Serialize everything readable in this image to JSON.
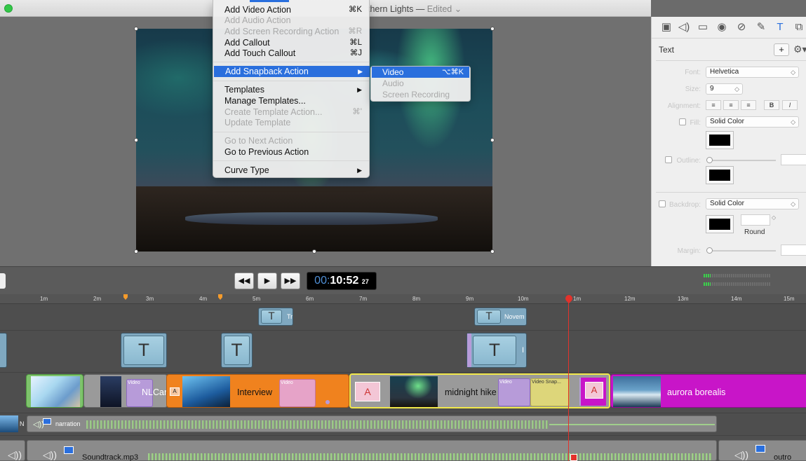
{
  "window": {
    "title": "Northern Lights",
    "title_visible": "thern Lights",
    "separator": "—",
    "status": "Edited",
    "status_chevron": "⌄"
  },
  "context_menu": {
    "items": [
      {
        "label": "Add Video Action",
        "shortcut": "⌘K",
        "enabled": true
      },
      {
        "label": "Add Audio Action",
        "shortcut": "",
        "enabled": false
      },
      {
        "label": "Add Screen Recording Action",
        "shortcut": "⌘R",
        "enabled": false
      },
      {
        "label": "Add Callout",
        "shortcut": "⌘L",
        "enabled": true
      },
      {
        "label": "Add Touch Callout",
        "shortcut": "⌘J",
        "enabled": true
      },
      {
        "label": "Add Snapback Action",
        "shortcut": "▶",
        "enabled": true,
        "highlighted": true
      },
      {
        "label": "Templates",
        "shortcut": "▶",
        "enabled": true
      },
      {
        "label": "Manage Templates...",
        "shortcut": "",
        "enabled": true
      },
      {
        "label": "Create Template Action...",
        "shortcut": "⌘'",
        "enabled": false
      },
      {
        "label": "Update Template",
        "shortcut": "",
        "enabled": false
      },
      {
        "label": "Go to Next Action",
        "shortcut": "",
        "enabled": false
      },
      {
        "label": "Go to Previous Action",
        "shortcut": "",
        "enabled": true
      },
      {
        "label": "Curve Type",
        "shortcut": "▶",
        "enabled": true
      }
    ],
    "submenu": [
      {
        "label": "Video",
        "shortcut": "⌥⌘K",
        "highlighted": true
      },
      {
        "label": "Audio",
        "shortcut": ""
      },
      {
        "label": "Screen Recording",
        "shortcut": ""
      }
    ]
  },
  "inspector": {
    "toolbar_icons": [
      "film-icon",
      "speaker-icon",
      "screen-icon",
      "cursor-icon",
      "shapes-icon",
      "pen-icon",
      "text-icon",
      "layers-icon"
    ],
    "toolbar_glyphs": [
      "▣",
      "◁)",
      "▭",
      "◉",
      "⊘",
      "✎",
      "T",
      "⧉"
    ],
    "title": "Text",
    "plus": "+",
    "gear": "⚙▾",
    "font_label": "Font:",
    "font_value": "Helvetica",
    "size_label": "Size:",
    "size_value": "9",
    "alignment_label": "Alignment:",
    "align_buttons": [
      "≡",
      "≡",
      "≡"
    ],
    "bold": "B",
    "italic": "I",
    "fill_label": "Fill:",
    "fill_value": "Solid Color",
    "fill_color": "#000000",
    "outline_label": "Outline:",
    "outline_color": "#000000",
    "backdrop_label": "Backdrop:",
    "backdrop_value": "Solid Color",
    "backdrop_color": "#000000",
    "round_label": "Round",
    "margin_label": "Margin:",
    "chevron": "◇"
  },
  "transport": {
    "rewind": "◀◀",
    "play": "▶",
    "forward": "▶▶",
    "time_dim": "00:",
    "time_main": "10:52",
    "frames": "27"
  },
  "ruler": {
    "ticks": [
      "1m",
      "2m",
      "3m",
      "4m",
      "5m",
      "6m",
      "7m",
      "8m",
      "9m",
      "10m",
      "1m",
      "12m",
      "13m",
      "14m",
      "15m"
    ]
  },
  "tracks": {
    "callout_track_a": [
      {
        "label": "Tr"
      },
      {
        "label": "Novem"
      }
    ],
    "callout_track_b": [
      {
        "label": ""
      },
      {
        "label": ""
      },
      {
        "label": ""
      },
      {
        "label": "I"
      }
    ],
    "text_glyph": "T",
    "video": [
      {
        "label": "NLCar"
      },
      {
        "label": "Interview"
      },
      {
        "label": "midnight hike"
      },
      {
        "label": "aurora borealis"
      }
    ],
    "video_action": "Video",
    "video_snapback": "Video Snap...",
    "narration": {
      "label": "narration",
      "prefix": "N"
    },
    "soundtrack": {
      "label": "Soundtrack.mp3"
    },
    "outro": {
      "label": "outro"
    },
    "speaker_glyph": "◁))"
  },
  "colors": {
    "accent": "#2a6fdd",
    "orange": "#f0821e",
    "magenta": "#c815c8",
    "playhead": "#e3322b",
    "selection": "#f1e84a",
    "audio": "#a0ce8c"
  }
}
